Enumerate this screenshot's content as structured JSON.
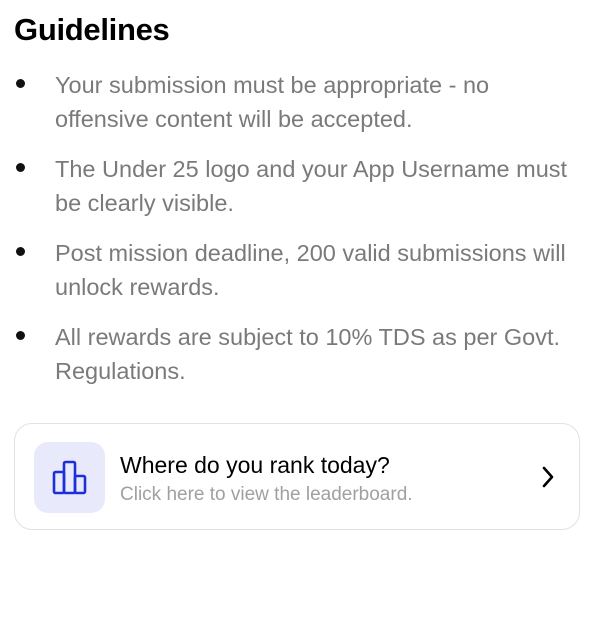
{
  "section": {
    "title": "Guidelines"
  },
  "guidelines": [
    {
      "text": "Your submission must be appropriate - no offensive content will be accepted."
    },
    {
      "text": "The Under 25 logo and your App Username must be clearly visible."
    },
    {
      "text": "Post mission deadline, 200 valid submissions will unlock rewards."
    },
    {
      "text": "All rewards are subject to 10% TDS as per Govt. Regulations."
    }
  ],
  "leaderboard_card": {
    "title": "Where do you rank today?",
    "subtitle": "Click here to view the leaderboard.",
    "icon": "leaderboard-icon",
    "action_icon": "chevron-right-icon"
  },
  "colors": {
    "accent": "#1d2fd9",
    "icon_bg": "#e8eafc",
    "body_text": "#7a7a7a",
    "heading_text": "#000000"
  }
}
